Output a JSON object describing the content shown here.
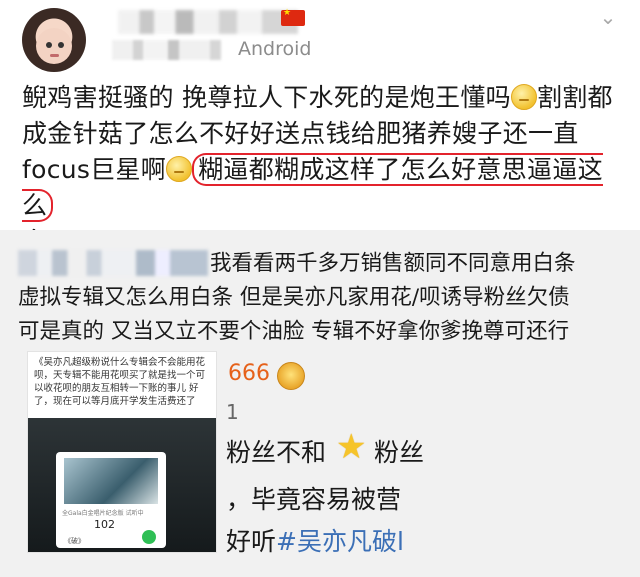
{
  "header": {
    "source": "Android",
    "chevron_icon": "chevron-down-icon"
  },
  "post": {
    "part1": "鲵鸡害挺骚的 挽尊拉人下水死的是炮王懂吗",
    "part2": "割割都成金针菇了怎么不好好送点钱给肥猪养嫂子还一直focus巨星啊",
    "highlight": "糊逼都糊成这样了怎么好意思逼逼这么",
    "part3": "多"
  },
  "repost": {
    "line1": "我看看两千多万销售额同不同意用白条",
    "line2": "虚拟专辑又怎么用白条 但是吴亦凡家用花/呗诱导粉丝欠债",
    "line3": "可是真的 又当又立不要个油脸 专辑不好拿你爹挽尊可还行",
    "frag_num": "666",
    "frag_1": "1",
    "frag_fans1": "粉丝不和",
    "frag_fans2": "粉丝",
    "frag_easy": "，毕竟容易被营",
    "frag_good": "好听",
    "frag_tag": "#吴亦凡破l"
  },
  "thumbnail": {
    "text": "《吴亦凡超级粉说什么专辑会不会能用花呗，天专辑不能用花呗买了就是找一个可以收花呗的朋友互相转一下账的事儿 好了，现在可以等月底开学发生活费还了",
    "small": "全Gala白金唱片纪念版 试听中",
    "count": "102",
    "label": "《破》"
  }
}
